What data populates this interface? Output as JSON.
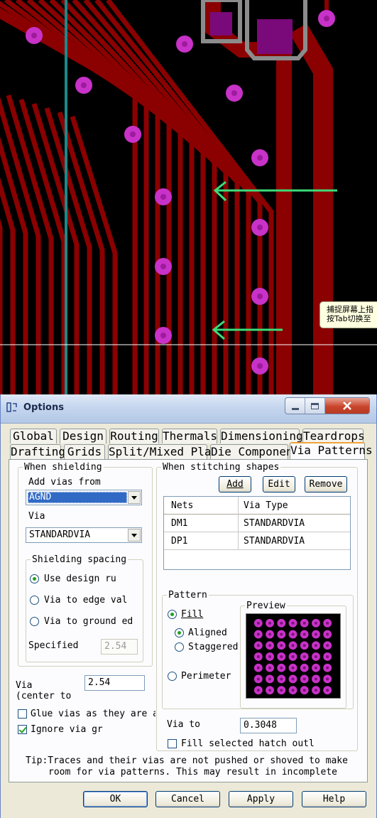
{
  "tooltip": {
    "line1": "捕捉屏幕上指",
    "line2": "按Tab切换至"
  },
  "dialog": {
    "title": "Options",
    "tabs_row1": [
      "Global",
      "Design",
      "Routing",
      "Thermals",
      "Dimensioning",
      "Teardrops"
    ],
    "tabs_row2": [
      "Drafting",
      "Grids",
      "Split/Mixed Plane",
      "Die Component",
      "Via Patterns"
    ],
    "active_tab": "Via Patterns",
    "shielding": {
      "legend": "When shielding",
      "add_vias_label": "Add vias from",
      "add_vias_value": "AGND",
      "via_label": "Via",
      "via_value": "STANDARDVIA",
      "spacing_legend": "Shielding spacing",
      "opt_design": "Use design ru",
      "opt_edge": "Via to edge val",
      "opt_ground": "Via to ground ed",
      "specified_label": "Specified",
      "specified_value": "2.54",
      "via_center_label1": "Via",
      "via_center_label2": "(center to",
      "via_center_value": "2.54",
      "glue_label": "Glue vias as they are ad",
      "glue_checked": false,
      "ignore_label": "Ignore via gr",
      "ignore_checked": true
    },
    "stitching": {
      "legend": "When stitching shapes",
      "add_button": "Add",
      "edit_button": "Edit",
      "remove_button": "Remove",
      "table": {
        "headers": [
          "Nets",
          "Via Type"
        ],
        "rows": [
          [
            "DM1",
            "STANDARDVIA"
          ],
          [
            "DP1",
            "STANDARDVIA"
          ]
        ]
      },
      "pattern_legend": "Pattern",
      "fill_label": "Fill",
      "aligned_label": "Aligned",
      "staggered_label": "Staggered",
      "perimeter_label": "Perimeter",
      "preview_legend": "Preview",
      "preview_grid": {
        "rows": 7,
        "cols": 7,
        "color": "#c832c8"
      },
      "via_to_label": "Via to",
      "via_to_value": "0.3048",
      "fill_hatch_label": "Fill selected hatch outl",
      "fill_hatch_checked": false
    },
    "tip_line1": "Tip:Traces and their vias are not pushed or shoved to make",
    "tip_line2": "room for via patterns. This may result in incomplete",
    "buttons": {
      "ok": "OK",
      "cancel": "Cancel",
      "apply": "Apply",
      "help": "Help"
    }
  },
  "colors": {
    "trace": "#8b0000",
    "via": "#c832c8",
    "arrow": "#3cdc78",
    "teal_trace": "#1a8a8a",
    "pad_outline": "#8c8c8c"
  }
}
